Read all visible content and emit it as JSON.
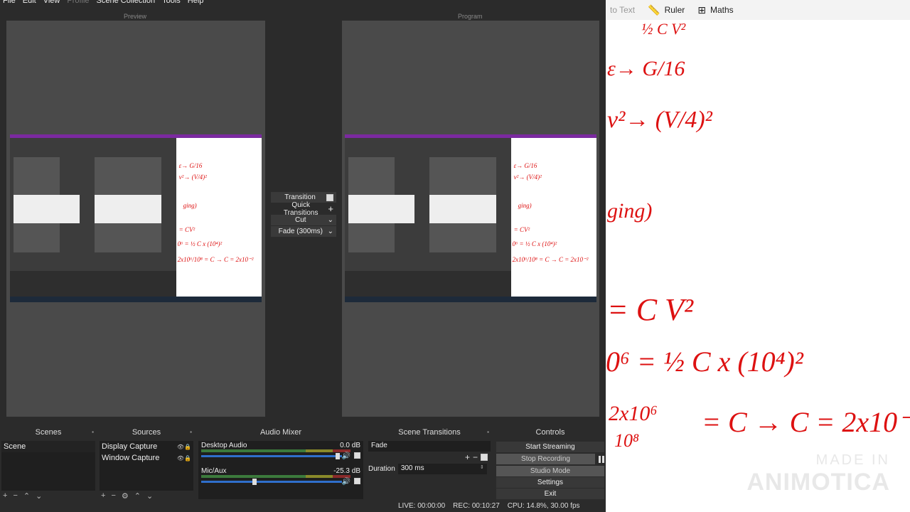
{
  "menu": [
    "File",
    "Edit",
    "View",
    "Profile",
    "Scene Collection",
    "Tools",
    "Help"
  ],
  "preview_label": "Preview",
  "program_label": "Program",
  "transition_panel": {
    "transition": "Transition",
    "quick_transitions": "Quick Transitions",
    "cut": "Cut",
    "fade": "Fade (300ms)"
  },
  "scenes": {
    "title": "Scenes",
    "items": [
      "Scene"
    ]
  },
  "sources": {
    "title": "Sources",
    "items": [
      "Display Capture",
      "Window Capture"
    ]
  },
  "audio_mixer": {
    "title": "Audio Mixer",
    "channels": [
      {
        "name": "Desktop Audio",
        "db": "0.0 dB",
        "level": 0.97
      },
      {
        "name": "Mic/Aux",
        "db": "-25.3 dB",
        "level": 0.38
      }
    ]
  },
  "scene_transitions": {
    "title": "Scene Transitions",
    "selected": "Fade",
    "duration_label": "Duration",
    "duration_value": "300 ms"
  },
  "controls": {
    "title": "Controls",
    "start_streaming": "Start Streaming",
    "stop_recording": "Stop Recording",
    "studio_mode": "Studio Mode",
    "settings": "Settings",
    "exit": "Exit"
  },
  "status": {
    "live": "LIVE: 00:00:00",
    "rec": "REC: 00:10:27",
    "cpu": "CPU: 14.8%, 30.00 fps"
  },
  "whiteboard": {
    "toolbar": {
      "to_text": "to Text",
      "ruler": "Ruler",
      "maths": "Maths"
    }
  },
  "watermark": {
    "line1": "MADE IN",
    "line2": "ANIMOTICA"
  },
  "colors": {
    "ink": "#dd1111",
    "obs_bg": "#2b2b2b",
    "accent_purple": "#7b2aa0"
  }
}
